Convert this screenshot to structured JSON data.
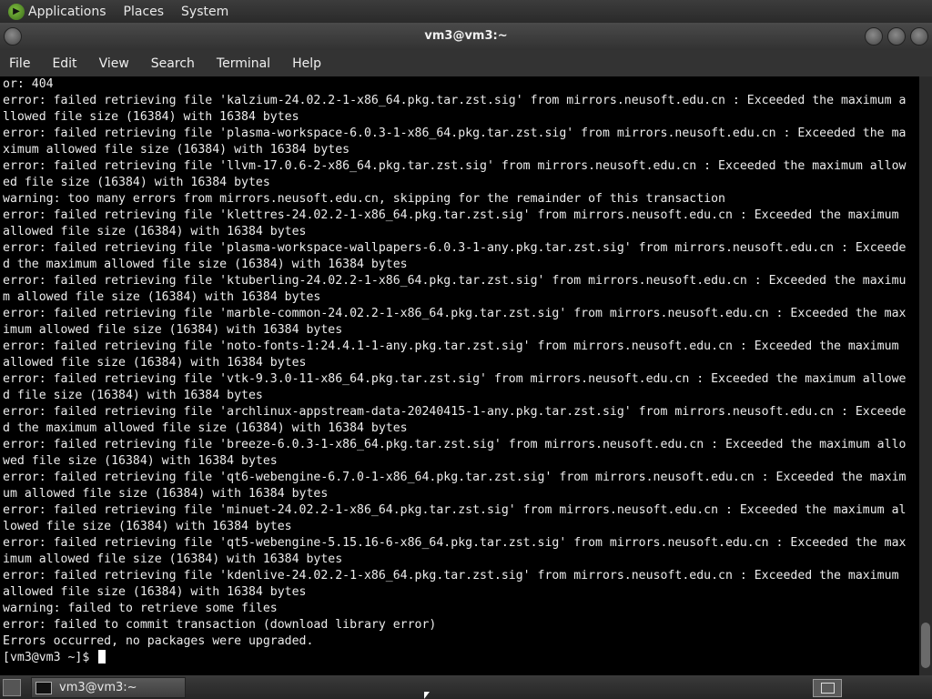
{
  "top_panel": {
    "applications": "Applications",
    "places": "Places",
    "system": "System"
  },
  "window": {
    "title": "vm3@vm3:~"
  },
  "menubar": {
    "file": "File",
    "edit": "Edit",
    "view": "View",
    "search": "Search",
    "terminal": "Terminal",
    "help": "Help"
  },
  "terminal": {
    "lines": [
      "or: 404",
      "error: failed retrieving file 'kalzium-24.02.2-1-x86_64.pkg.tar.zst.sig' from mirrors.neusoft.edu.cn : Exceeded the maximum a",
      "llowed file size (16384) with 16384 bytes",
      "error: failed retrieving file 'plasma-workspace-6.0.3-1-x86_64.pkg.tar.zst.sig' from mirrors.neusoft.edu.cn : Exceeded the ma",
      "ximum allowed file size (16384) with 16384 bytes",
      "error: failed retrieving file 'llvm-17.0.6-2-x86_64.pkg.tar.zst.sig' from mirrors.neusoft.edu.cn : Exceeded the maximum allow",
      "ed file size (16384) with 16384 bytes",
      "warning: too many errors from mirrors.neusoft.edu.cn, skipping for the remainder of this transaction",
      "error: failed retrieving file 'klettres-24.02.2-1-x86_64.pkg.tar.zst.sig' from mirrors.neusoft.edu.cn : Exceeded the maximum",
      "allowed file size (16384) with 16384 bytes",
      "error: failed retrieving file 'plasma-workspace-wallpapers-6.0.3-1-any.pkg.tar.zst.sig' from mirrors.neusoft.edu.cn : Exceede",
      "d the maximum allowed file size (16384) with 16384 bytes",
      "error: failed retrieving file 'ktuberling-24.02.2-1-x86_64.pkg.tar.zst.sig' from mirrors.neusoft.edu.cn : Exceeded the maximu",
      "m allowed file size (16384) with 16384 bytes",
      "error: failed retrieving file 'marble-common-24.02.2-1-x86_64.pkg.tar.zst.sig' from mirrors.neusoft.edu.cn : Exceeded the max",
      "imum allowed file size (16384) with 16384 bytes",
      "error: failed retrieving file 'noto-fonts-1:24.4.1-1-any.pkg.tar.zst.sig' from mirrors.neusoft.edu.cn : Exceeded the maximum",
      "allowed file size (16384) with 16384 bytes",
      "error: failed retrieving file 'vtk-9.3.0-11-x86_64.pkg.tar.zst.sig' from mirrors.neusoft.edu.cn : Exceeded the maximum allowe",
      "d file size (16384) with 16384 bytes",
      "error: failed retrieving file 'archlinux-appstream-data-20240415-1-any.pkg.tar.zst.sig' from mirrors.neusoft.edu.cn : Exceede",
      "d the maximum allowed file size (16384) with 16384 bytes",
      "error: failed retrieving file 'breeze-6.0.3-1-x86_64.pkg.tar.zst.sig' from mirrors.neusoft.edu.cn : Exceeded the maximum allo",
      "wed file size (16384) with 16384 bytes",
      "error: failed retrieving file 'qt6-webengine-6.7.0-1-x86_64.pkg.tar.zst.sig' from mirrors.neusoft.edu.cn : Exceeded the maxim",
      "um allowed file size (16384) with 16384 bytes",
      "error: failed retrieving file 'minuet-24.02.2-1-x86_64.pkg.tar.zst.sig' from mirrors.neusoft.edu.cn : Exceeded the maximum al",
      "lowed file size (16384) with 16384 bytes",
      "error: failed retrieving file 'qt5-webengine-5.15.16-6-x86_64.pkg.tar.zst.sig' from mirrors.neusoft.edu.cn : Exceeded the max",
      "imum allowed file size (16384) with 16384 bytes",
      "error: failed retrieving file 'kdenlive-24.02.2-1-x86_64.pkg.tar.zst.sig' from mirrors.neusoft.edu.cn : Exceeded the maximum",
      "allowed file size (16384) with 16384 bytes",
      "warning: failed to retrieve some files",
      "error: failed to commit transaction (download library error)",
      "Errors occurred, no packages were upgraded."
    ],
    "prompt": "[vm3@vm3 ~]$ "
  },
  "taskbar": {
    "task_label": "vm3@vm3:~"
  }
}
